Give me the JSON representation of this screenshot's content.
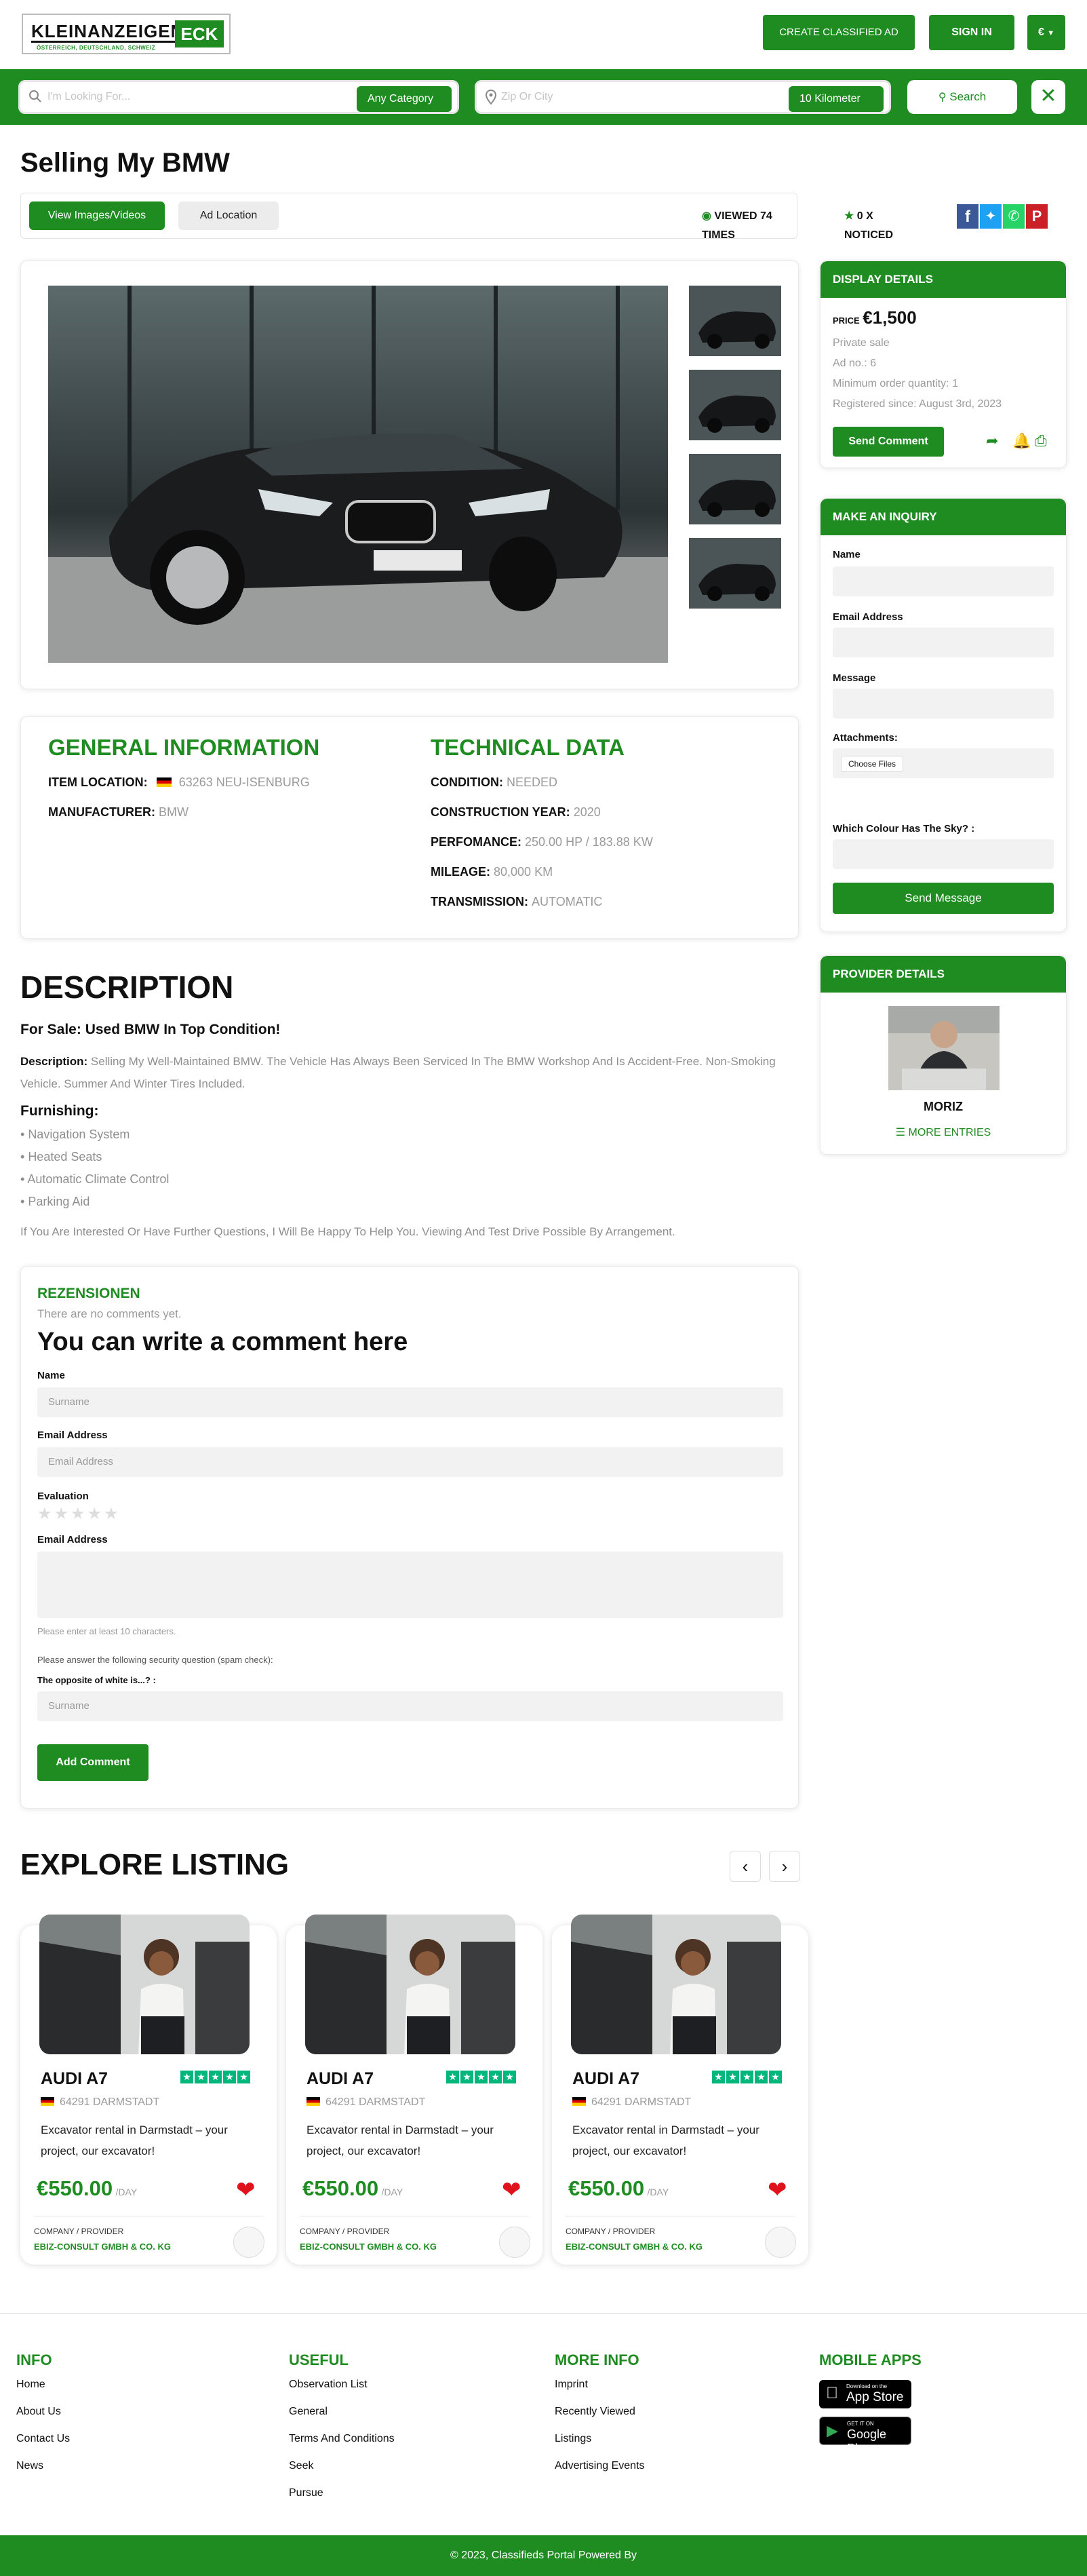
{
  "header": {
    "logo_text": "KLEINANZEIGEN",
    "logo_accent": "ECK",
    "logo_tagline": "ÖSTERREICH, DEUTSCHLAND, SCHWEIZ",
    "create_ad": "CREATE CLASSIFIED AD",
    "sign_in": "SIGN IN",
    "currency": "€"
  },
  "search": {
    "keyword_placeholder": "I'm Looking For...",
    "category": "Any Category",
    "location_placeholder": "Zip Or City",
    "radius": "10 Kilometer",
    "search_label": "Search"
  },
  "listing": {
    "title": "Selling My BMW",
    "tab_images": "View Images/Videos",
    "tab_location": "Ad Location",
    "views": "VIEWED 74 TIMES",
    "noticed": "0 X NOTICED"
  },
  "general": {
    "heading": "GENERAL INFORMATION",
    "location_label": "ITEM LOCATION:",
    "location_value": "63263 NEU-ISENBURG",
    "manufacturer_label": "MANUFACTURER:",
    "manufacturer_value": "BMW"
  },
  "technical": {
    "heading": "TECHNICAL DATA",
    "rows": [
      {
        "label": "CONDITION:",
        "value": "NEEDED"
      },
      {
        "label": "CONSTRUCTION YEAR:",
        "value": "2020"
      },
      {
        "label": "PERFOMANCE:",
        "value": "250.00 HP / 183.88 KW"
      },
      {
        "label": "MILEAGE:",
        "value": "80,000 KM"
      },
      {
        "label": "TRANSMISSION:",
        "value": "AUTOMATIC"
      }
    ]
  },
  "display": {
    "heading": "DISPLAY DETAILS",
    "price_label": "PRICE",
    "price": "€1,500",
    "lines": [
      "Private sale",
      "Ad no.: 6",
      "Minimum order quantity: 1",
      "Registered since: August 3rd, 2023"
    ],
    "send_comment": "Send Comment"
  },
  "inquiry": {
    "heading": "MAKE AN INQUIRY",
    "name": "Name",
    "email": "Email Address",
    "message": "Message",
    "attachments": "Attachments:",
    "choose_files": "Choose Files",
    "question": "Which Colour Has The Sky? :",
    "send": "Send Message"
  },
  "provider": {
    "heading": "PROVIDER DETAILS",
    "name": "MORIZ",
    "more": "MORE ENTRIES"
  },
  "description": {
    "heading": "DESCRIPTION",
    "subtitle": "For Sale: Used BMW In Top Condition!",
    "label": "Description:",
    "text": "Selling My Well-Maintained BMW. The Vehicle Has Always Been Serviced In The BMW Workshop And Is Accident-Free. Non-Smoking Vehicle. Summer And Winter Tires Included.",
    "furnishing_heading": "Furnishing:",
    "items": [
      "Navigation System",
      "Heated Seats",
      "Automatic Climate Control",
      "Parking Aid"
    ],
    "closing": "If You Are Interested Or Have Further Questions, I Will Be Happy To Help You. Viewing And Test Drive Possible By Arrangement."
  },
  "reviews": {
    "heading": "REZENSIONEN",
    "none": "There are no comments yet.",
    "write": "You can write a comment here",
    "name_label": "Name",
    "name_ph": "Surname",
    "email_label": "Email Address",
    "email_ph": "Email Address",
    "evaluation": "Evaluation",
    "comment_label": "Email Address",
    "min_chars": "Please enter at least 10 characters.",
    "spam_note": "Please answer the following security question (spam check):",
    "spam_question": "The opposite of white is...? :",
    "spam_ph": "Surname",
    "submit": "Add Comment"
  },
  "explore": {
    "heading": "EXPLORE LISTING",
    "cards": [
      {
        "title": "AUDI A7",
        "location": "64291 DARMSTADT",
        "desc": "Excavator rental in Darmstadt – your project, our excavator!",
        "price": "€550.00",
        "unit": "/DAY",
        "provider_label": "COMPANY / PROVIDER",
        "provider": "EBIZ-CONSULT GMBH & CO. KG"
      },
      {
        "title": "AUDI A7",
        "location": "64291 DARMSTADT",
        "desc": "Excavator rental in Darmstadt – your project, our excavator!",
        "price": "€550.00",
        "unit": "/DAY",
        "provider_label": "COMPANY / PROVIDER",
        "provider": "EBIZ-CONSULT GMBH & CO. KG"
      },
      {
        "title": "AUDI A7",
        "location": "64291 DARMSTADT",
        "desc": "Excavator rental in Darmstadt – your project, our excavator!",
        "price": "€550.00",
        "unit": "/DAY",
        "provider_label": "COMPANY / PROVIDER",
        "provider": "EBIZ-CONSULT GMBH & CO. KG"
      }
    ]
  },
  "footer": {
    "info": {
      "heading": "INFO",
      "links": [
        "Home",
        "About Us",
        "Contact Us",
        "News"
      ]
    },
    "useful": {
      "heading": "USEFUL",
      "links": [
        "Observation List",
        "General",
        "Terms And Conditions",
        "Seek",
        "Pursue"
      ]
    },
    "more": {
      "heading": "MORE INFO",
      "links": [
        "Imprint",
        "Recently Viewed",
        "Listings",
        "Advertising Events"
      ]
    },
    "apps": {
      "heading": "MOBILE APPS",
      "appstore_small": "Download on the",
      "appstore": "App Store",
      "gplay_small": "GET IT ON",
      "gplay": "Google Play"
    },
    "copyright": "© 2023, Classifieds Portal Powered By"
  },
  "colors": {
    "brand_green": "#1f8c22",
    "heart_red": "#e0121b"
  }
}
